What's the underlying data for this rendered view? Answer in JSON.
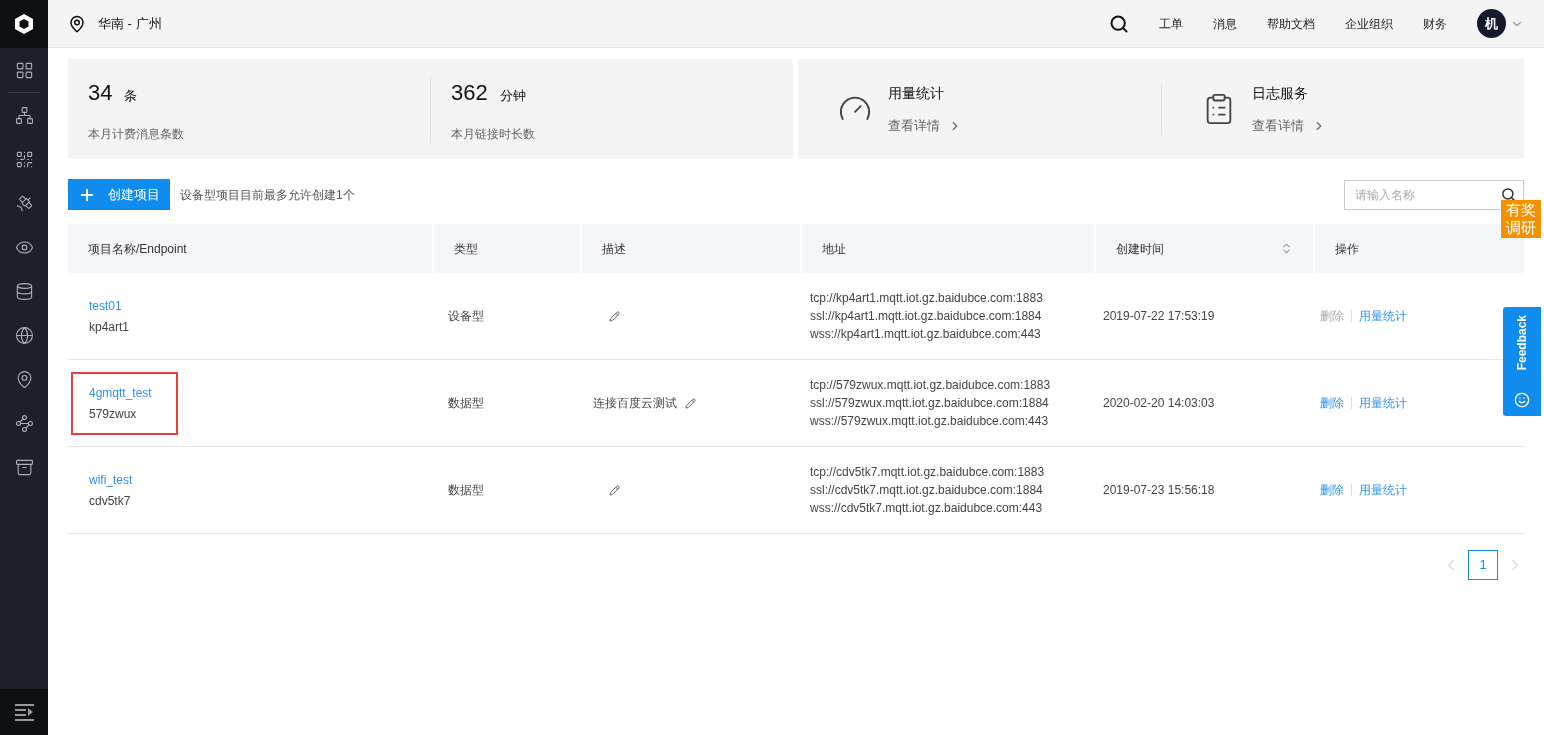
{
  "header": {
    "region": "华南 - 广州",
    "nav": [
      "工单",
      "消息",
      "帮助文档",
      "企业组织",
      "财务"
    ],
    "avatar": "机"
  },
  "stats": [
    {
      "value": "34",
      "unit": "条",
      "label": "本月计费消息条数"
    },
    {
      "value": "362",
      "unit": "分钟",
      "label": "本月链接时长数"
    }
  ],
  "shortcuts": [
    {
      "kind": "gauge",
      "title": "用量统计",
      "link": "查看详情"
    },
    {
      "kind": "log",
      "title": "日志服务",
      "link": "查看详情"
    }
  ],
  "toolbar": {
    "create_button": "创建项目",
    "hint": "设备型项目目前最多允许创建1个",
    "search": {
      "placeholder": "请输入名称"
    }
  },
  "table": {
    "columns": [
      {
        "label": "项目名称/Endpoint",
        "sortable": false
      },
      {
        "label": "类型",
        "sortable": false
      },
      {
        "label": "描述",
        "sortable": false
      },
      {
        "label": "地址",
        "sortable": false
      },
      {
        "label": "创建时间",
        "sortable": true
      },
      {
        "label": "操作",
        "sortable": false
      }
    ],
    "rows": [
      {
        "name": "test01",
        "endpoint": "kp4art1",
        "highlighted": false,
        "type": "设备型",
        "description": "",
        "addresses": [
          "tcp://kp4art1.mqtt.iot.gz.baidubce.com:1883",
          "ssl://kp4art1.mqtt.iot.gz.baidubce.com:1884",
          "wss://kp4art1.mqtt.iot.gz.baidubce.com:443"
        ],
        "created": "2019-07-22 17:53:19",
        "actions": [
          {
            "label": "删除",
            "disabled": true
          },
          {
            "label": "用量统计",
            "disabled": false
          }
        ]
      },
      {
        "name": "4gmqtt_test",
        "endpoint": "579zwux",
        "highlighted": true,
        "type": "数据型",
        "description": "连接百度云测试",
        "addresses": [
          "tcp://579zwux.mqtt.iot.gz.baidubce.com:1883",
          "ssl://579zwux.mqtt.iot.gz.baidubce.com:1884",
          "wss://579zwux.mqtt.iot.gz.baidubce.com:443"
        ],
        "created": "2020-02-20 14:03:03",
        "actions": [
          {
            "label": "删除",
            "disabled": false
          },
          {
            "label": "用量统计",
            "disabled": false
          }
        ]
      },
      {
        "name": "wifi_test",
        "endpoint": "cdv5tk7",
        "highlighted": false,
        "type": "数据型",
        "description": "",
        "addresses": [
          "tcp://cdv5tk7.mqtt.iot.gz.baidubce.com:1883",
          "ssl://cdv5tk7.mqtt.iot.gz.baidubce.com:1884",
          "wss://cdv5tk7.mqtt.iot.gz.baidubce.com:443"
        ],
        "created": "2019-07-23 15:56:18",
        "actions": [
          {
            "label": "删除",
            "disabled": false
          },
          {
            "label": "用量统计",
            "disabled": false
          }
        ]
      }
    ]
  },
  "pagination": {
    "pages": [
      {
        "label": "1",
        "selected": true
      }
    ]
  },
  "survey_badge": "有奖调研",
  "feedback_tab": "Feedback"
}
